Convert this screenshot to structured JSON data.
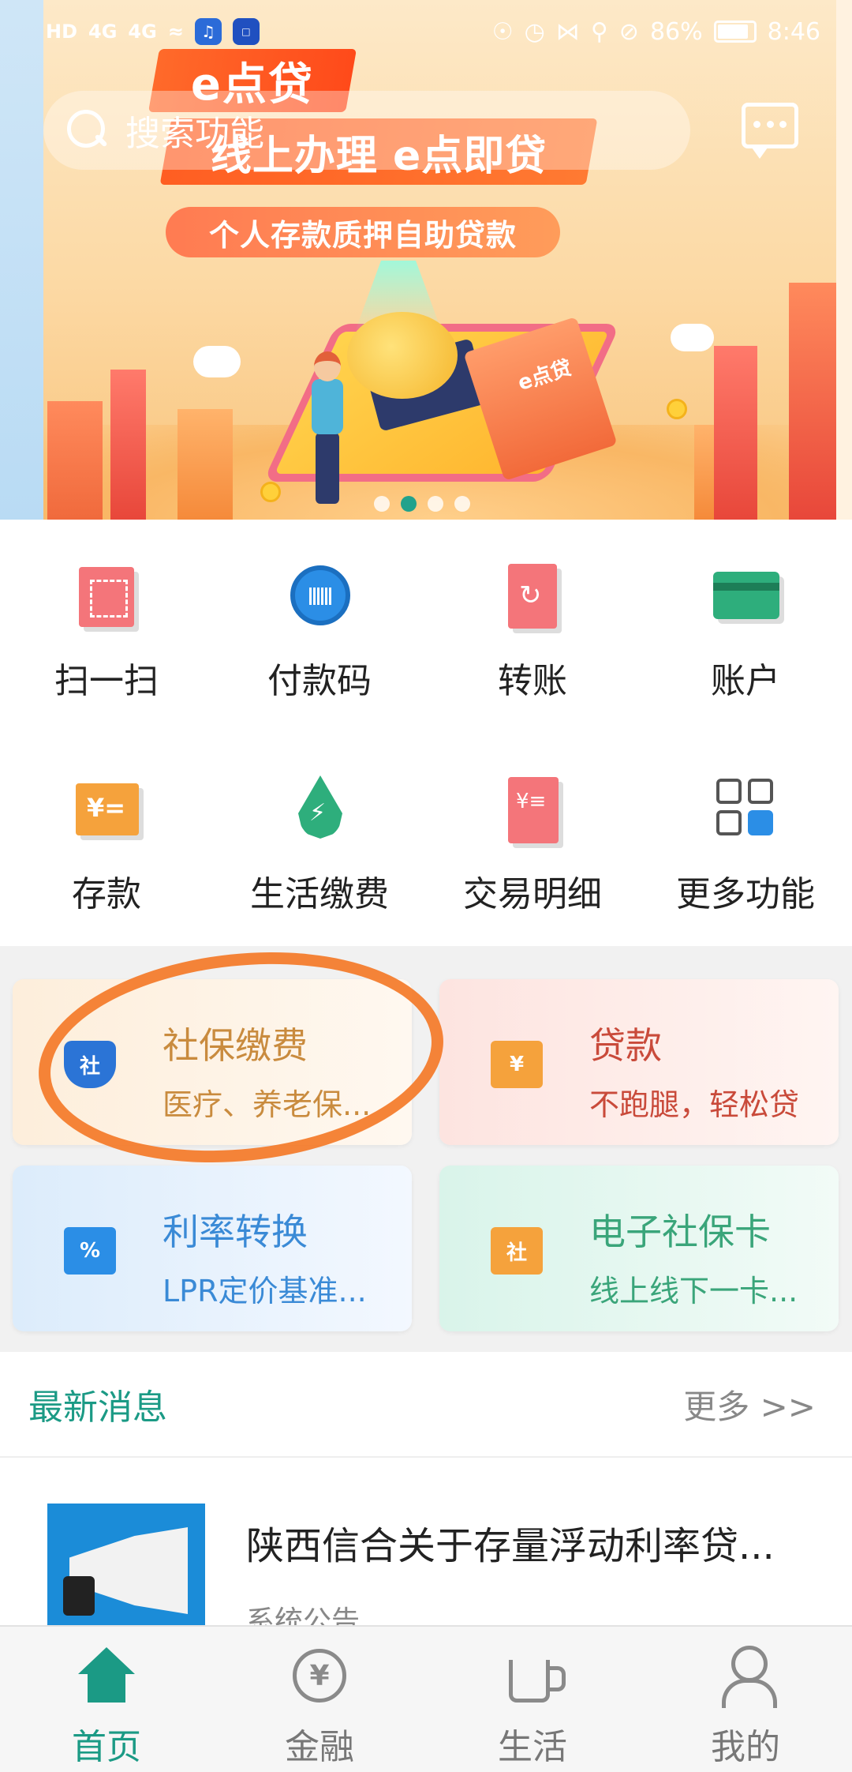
{
  "status_bar": {
    "network": "HD",
    "signal_1": "4G",
    "signal_2": "4G",
    "battery": "86%",
    "time": "8:46"
  },
  "search": {
    "placeholder": "搜索功能"
  },
  "banner": {
    "title": "e点贷",
    "subtitle": "线上办理 e点即贷",
    "tagline": "个人存款质押自助贷款",
    "ticket_label": "e点贷",
    "slide_count": 4,
    "active_slide": 2
  },
  "grid": {
    "scan": "扫一扫",
    "pay_code": "付款码",
    "transfer": "转账",
    "account": "账户",
    "deposit": "存款",
    "utilities": "生活缴费",
    "transactions": "交易明细",
    "more": "更多功能"
  },
  "promos": {
    "social": {
      "title": "社保缴费",
      "subtitle": "医疗、养老保...",
      "icon": "社"
    },
    "loan": {
      "title": "贷款",
      "subtitle": "不跑腿，轻松贷",
      "icon": "¥"
    },
    "rate": {
      "title": "利率转换",
      "subtitle": "LPR定价基准...",
      "icon": "%"
    },
    "ecard": {
      "title": "电子社保卡",
      "subtitle": "线上线下一卡...",
      "icon": "社"
    }
  },
  "news": {
    "section_title": "最新消息",
    "more": "更多 >>",
    "items": [
      {
        "headline": "陕西信合关于存量浮动利率贷...",
        "meta": "系统公告"
      }
    ]
  },
  "tabs": [
    {
      "label": "首页",
      "active": true
    },
    {
      "label": "金融",
      "active": false
    },
    {
      "label": "生活",
      "active": false
    },
    {
      "label": "我的",
      "active": false
    }
  ],
  "colors": {
    "accent": "#1b9a85",
    "highlight_oval": "#f47a28"
  }
}
